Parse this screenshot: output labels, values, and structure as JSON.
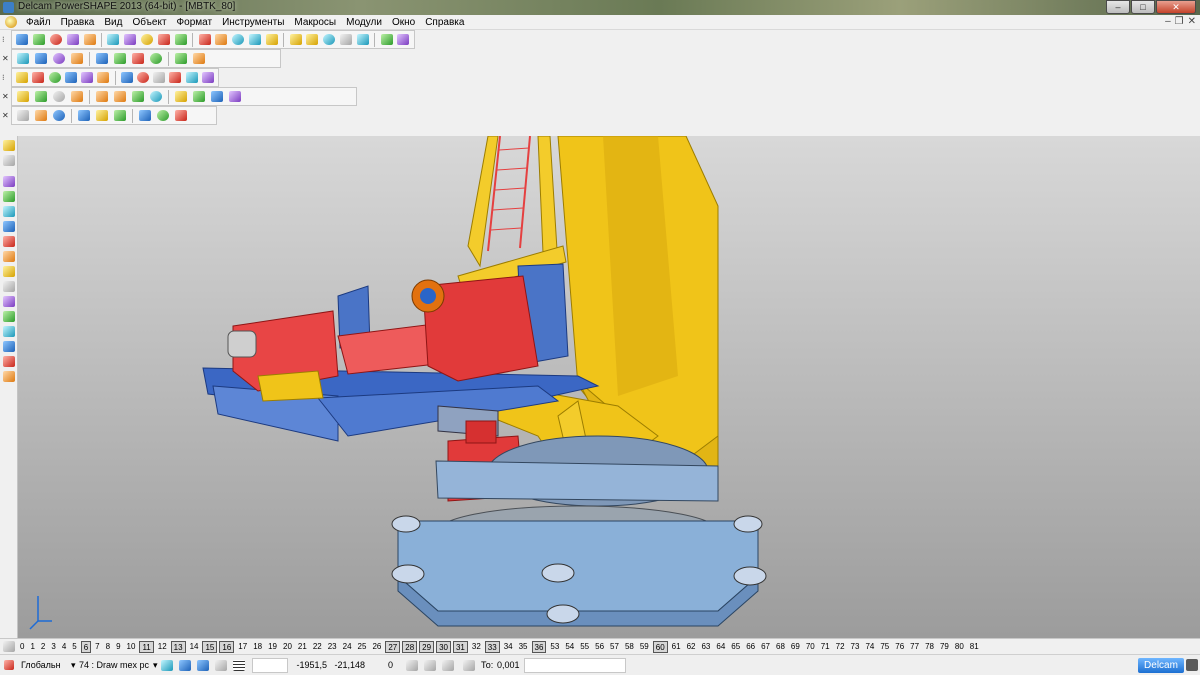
{
  "window": {
    "title": "Delcam PowerSHAPE 2013 (64-bit) - [MBTK_80]",
    "buttons": {
      "minimize": "–",
      "maximize": "□",
      "close": "✕"
    }
  },
  "menu": {
    "items": [
      "Файл",
      "Правка",
      "Вид",
      "Объект",
      "Формат",
      "Инструменты",
      "Макросы",
      "Модули",
      "Окно",
      "Справка"
    ],
    "doc_controls": [
      "–",
      "❐",
      "✕"
    ]
  },
  "colors": {
    "viewport_top": "#d8d8d8",
    "viewport_bottom": "#9c9c9c",
    "crane_yellow": "#f0c419",
    "part_blue": "#4a79c9",
    "part_red": "#e84545",
    "base_lightblue": "#8fb1d6"
  },
  "toolbars": {
    "row1_icons": [
      "new-icon",
      "open-icon",
      "save-icon",
      "save-as-icon",
      "print-icon",
      "cut-icon",
      "copy-icon",
      "paste-icon",
      "delete-icon",
      "undo-icon",
      "redo-icon",
      "select-icon",
      "line-icon",
      "arc-icon",
      "circle-icon",
      "curve-icon",
      "text-icon",
      "surface-icon",
      "solid-icon",
      "shade-icon",
      "wireframe-icon",
      "tools-icon"
    ],
    "row2_icons": [
      "view-top-icon",
      "view-front-icon",
      "view-iso-icon",
      "rotate-icon",
      "zoom-in-icon",
      "zoom-out-icon",
      "zoom-fit-icon",
      "render-icon",
      "light-icon",
      "material-icon"
    ],
    "row3_icons": [
      "grid-icon",
      "plane-icon",
      "box-icon",
      "cylinder-icon",
      "sphere-icon",
      "cone-icon",
      "torus-icon",
      "extrude-icon",
      "revolve-icon",
      "blend-icon",
      "fillet-icon",
      "boolean-icon"
    ],
    "row4_icons": [
      "mesh-icon",
      "wrap-icon",
      "shell-icon",
      "offset-icon",
      "split-icon",
      "trim-icon",
      "project-icon",
      "intersect-icon",
      "join-icon",
      "fill-icon",
      "curve-net-icon",
      "section-icon"
    ],
    "row5_icons": [
      "measure-icon",
      "analysis-icon",
      "dimension-icon",
      "annotate-icon",
      "assembly-icon",
      "drafting-icon",
      "check-icon",
      "report-icon",
      "export-icon"
    ]
  },
  "left_toolbar": [
    "pointer-icon",
    "multi-select-icon",
    "layer-icon",
    "box-select-icon",
    "copy-obj-icon",
    "move-icon",
    "solid-tool-icon",
    "surface-tool-icon",
    "curve-tool-icon",
    "wire-tool-icon",
    "mesh-tool-icon",
    "text-tool-icon",
    "dim-tool-icon",
    "feature-tool-icon",
    "electrode-tool-icon",
    "assembly-tool-icon"
  ],
  "layers": {
    "items": [
      "0",
      "1",
      "2",
      "3",
      "4",
      "5",
      "6",
      "7",
      "8",
      "9",
      "10",
      "11",
      "12",
      "13",
      "14",
      "15",
      "16",
      "17",
      "18",
      "19",
      "20",
      "21",
      "22",
      "23",
      "24",
      "25",
      "26",
      "27",
      "28",
      "29",
      "30",
      "31",
      "32",
      "33",
      "34",
      "35",
      "36",
      "53",
      "54",
      "55",
      "56",
      "57",
      "58",
      "59",
      "60",
      "61",
      "62",
      "63",
      "64",
      "65",
      "66",
      "67",
      "68",
      "69",
      "70",
      "71",
      "72",
      "73",
      "74",
      "75",
      "76",
      "77",
      "78",
      "79",
      "80",
      "81"
    ],
    "boxed": [
      "6",
      "11",
      "13",
      "15",
      "16",
      "27",
      "28",
      "29",
      "30",
      "31",
      "33",
      "36",
      "60"
    ]
  },
  "status": {
    "workplane": "Глобальн",
    "level": "74 : Draw mex pc",
    "x": "-1951,5",
    "y": "-21,148",
    "z": "0",
    "tolerance_label": "То:",
    "tolerance": "0,001",
    "brand": "Delcam"
  }
}
